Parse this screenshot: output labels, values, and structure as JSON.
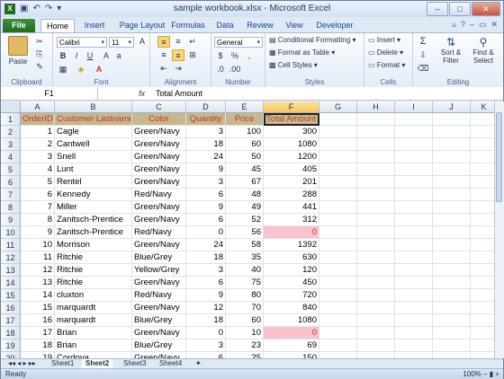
{
  "window": {
    "title": "sample workbook.xlsx - Microsoft Excel"
  },
  "tabs": [
    "File",
    "Home",
    "Insert",
    "Page Layout",
    "Formulas",
    "Data",
    "Review",
    "View",
    "Developer"
  ],
  "ribbon": {
    "clipboard": {
      "label": "Clipboard",
      "paste": "Paste"
    },
    "font": {
      "label": "Font",
      "name": "Calibri",
      "size": "11"
    },
    "alignment": {
      "label": "Alignment"
    },
    "number": {
      "label": "Number",
      "format": "General"
    },
    "styles": {
      "label": "Styles",
      "conditional": "Conditional Formatting",
      "format_table": "Format as Table",
      "cell_styles": "Cell Styles"
    },
    "cells": {
      "label": "Cells",
      "insert": "Insert",
      "delete": "Delete",
      "format": "Format"
    },
    "editing": {
      "label": "Editing",
      "sort": "Sort &",
      "sort2": "Filter",
      "find": "Find &",
      "find2": "Select"
    }
  },
  "formula_bar": {
    "name_box": "F1",
    "fx": "fx",
    "value": "Total Amount"
  },
  "columns": [
    "A",
    "B",
    "C",
    "D",
    "E",
    "F",
    "G",
    "H",
    "I",
    "J",
    "K"
  ],
  "header_row": [
    "OrderID",
    "Customer Lastname",
    "Color",
    "Quantity",
    "Price",
    "Total Amount"
  ],
  "rows": [
    [
      "1",
      "Cagle",
      "Green/Navy",
      "3",
      "100",
      "300"
    ],
    [
      "2",
      "Cantwell",
      "Green/Navy",
      "18",
      "60",
      "1080"
    ],
    [
      "3",
      "Snell",
      "Green/Navy",
      "24",
      "50",
      "1200"
    ],
    [
      "4",
      "Lunt",
      "Green/Navy",
      "9",
      "45",
      "405"
    ],
    [
      "5",
      "Rentel",
      "Green/Navy",
      "3",
      "67",
      "201"
    ],
    [
      "6",
      "Kennedy",
      "Red/Navy",
      "6",
      "48",
      "288"
    ],
    [
      "7",
      "Miller",
      "Green/Navy",
      "9",
      "49",
      "441"
    ],
    [
      "8",
      "Zanitsch-Prentice",
      "Green/Navy",
      "6",
      "52",
      "312"
    ],
    [
      "9",
      "Zanitsch-Prentice",
      "Red/Navy",
      "0",
      "56",
      "0"
    ],
    [
      "10",
      "Morrison",
      "Green/Navy",
      "24",
      "58",
      "1392"
    ],
    [
      "11",
      "Ritchie",
      "Blue/Grey",
      "18",
      "35",
      "630"
    ],
    [
      "12",
      "Ritchie",
      "Yellow/Grey",
      "3",
      "40",
      "120"
    ],
    [
      "13",
      "Ritchie",
      "Green/Navy",
      "6",
      "75",
      "450"
    ],
    [
      "14",
      "cluxton",
      "Red/Navy",
      "9",
      "80",
      "720"
    ],
    [
      "15",
      "marquardt",
      "Green/Navy",
      "12",
      "70",
      "840"
    ],
    [
      "16",
      "marquardt",
      "Blue/Grey",
      "18",
      "60",
      "1080"
    ],
    [
      "17",
      "Brian",
      "Green/Navy",
      "0",
      "10",
      "0"
    ],
    [
      "18",
      "Brian",
      "Blue/Grey",
      "3",
      "23",
      "69"
    ],
    [
      "19",
      "Cordova",
      "Green/Navy",
      "6",
      "25",
      "150"
    ]
  ],
  "sheets": [
    "Sheet1",
    "Sheet2",
    "Sheet3",
    "Sheet4"
  ],
  "status": {
    "ready": "Ready",
    "zoom": "100%"
  }
}
